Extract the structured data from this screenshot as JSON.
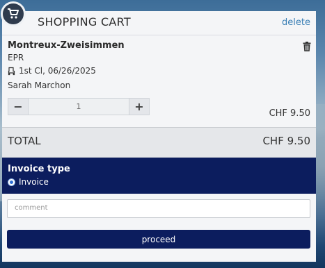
{
  "header": {
    "title": "SHOPPING CART",
    "delete_label": "delete"
  },
  "item": {
    "title": "Montreux-Zweisimmen",
    "operator": "EPR",
    "seat_info": "1st Cl, 06/26/2025",
    "passenger": "Sarah Marchon",
    "quantity": "1",
    "minus_label": "−",
    "plus_label": "+",
    "price": "CHF 9.50"
  },
  "total": {
    "label": "TOTAL",
    "amount": "CHF 9.50"
  },
  "invoice": {
    "title": "Invoice type",
    "option_label": "Invoice"
  },
  "comment": {
    "placeholder": "comment",
    "value": ""
  },
  "proceed_label": "proceed",
  "colors": {
    "accent": "#0c1d5e",
    "link": "#3a7fb5",
    "badge": "#2f3b4d"
  },
  "icons": {
    "badge": "shopping-cart-icon",
    "trash": "trash-icon",
    "seat": "seat-icon"
  }
}
